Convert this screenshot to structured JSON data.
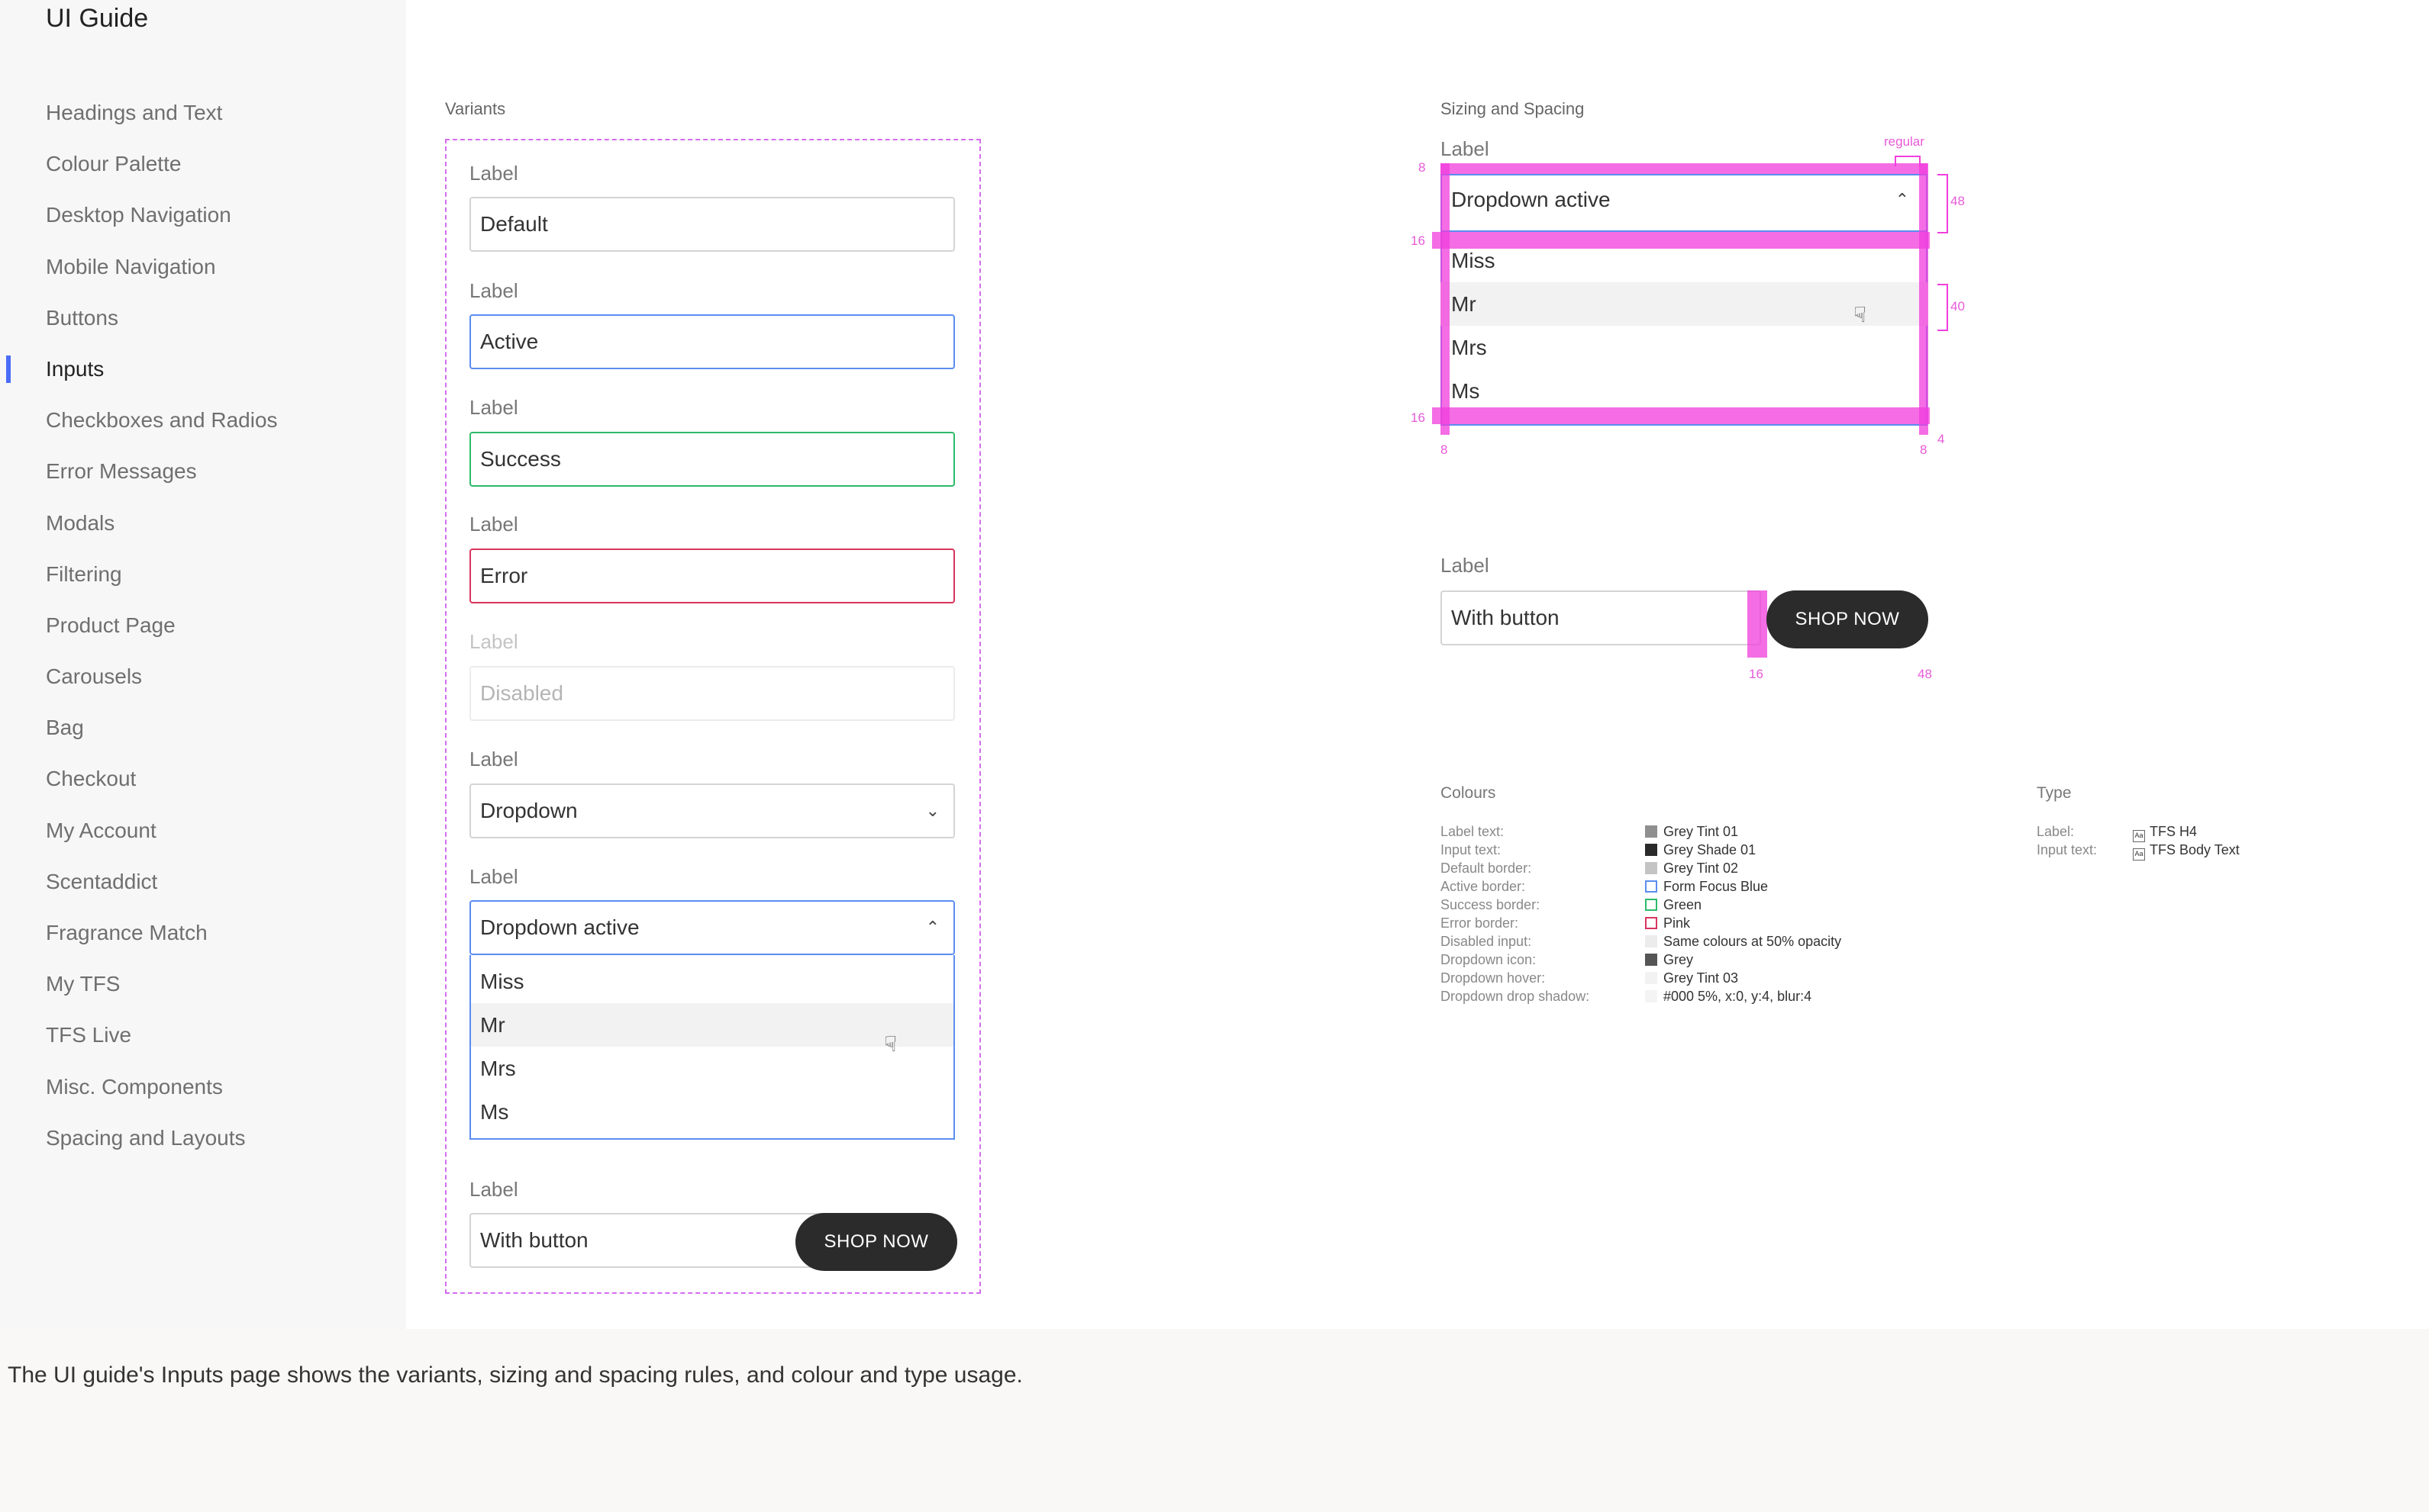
{
  "app": {
    "title": "UI Guide"
  },
  "nav": [
    "Headings and Text",
    "Colour Palette",
    "Desktop Navigation",
    "Mobile Navigation",
    "Buttons",
    "Inputs",
    "Checkboxes and Radios",
    "Error Messages",
    "Modals",
    "Filtering",
    "Product Page",
    "Carousels",
    "Bag",
    "Checkout",
    "My Account",
    "Scentaddict",
    "Fragrance Match",
    "My TFS",
    "TFS Live",
    "Misc. Components",
    "Spacing and Layouts"
  ],
  "active_nav": "Inputs",
  "variants": {
    "title": "Variants",
    "field_label": "Label",
    "default": "Default",
    "active": "Active",
    "success": "Success",
    "error": "Error",
    "disabled": "Disabled",
    "dropdown": "Dropdown",
    "dropdown_active": "Dropdown active",
    "options": [
      "Miss",
      "Mr",
      "Mrs",
      "Ms"
    ],
    "hovered_option": "Mr",
    "with_button": "With button",
    "button": "SHOP NOW"
  },
  "spacing": {
    "title": "Sizing and Spacing",
    "label": "Label",
    "dropdown_value": "Dropdown active",
    "options": [
      "Miss",
      "Mr",
      "Mrs",
      "Ms"
    ],
    "regular": "regular",
    "dims": {
      "pad_8": "8",
      "pad_16": "16",
      "height_48": "48",
      "row_40": "40",
      "radius_4": "4"
    },
    "with_button_label": "Label",
    "with_button_value": "With button",
    "button": "SHOP NOW",
    "gap_16": "16",
    "btn_48": "48"
  },
  "colours": {
    "title": "Colours",
    "rows": [
      {
        "key": "Label text:",
        "value": "Grey Tint 01",
        "swatch": "#8f8f8f",
        "style": "fill"
      },
      {
        "key": "Input text:",
        "value": "Grey Shade 01",
        "swatch": "#2a2a2a",
        "style": "fill"
      },
      {
        "key": "Default border:",
        "value": "Grey Tint 02",
        "swatch": "#c4c4c4",
        "style": "fill"
      },
      {
        "key": "Active border:",
        "value": "Form Focus Blue",
        "swatch": "#5a8df0",
        "style": "outline"
      },
      {
        "key": "Success border:",
        "value": "Green",
        "swatch": "#2dbb6a",
        "style": "outline"
      },
      {
        "key": "Error border:",
        "value": "Pink",
        "swatch": "#d8345f",
        "style": "outline"
      },
      {
        "key": "Disabled input:",
        "value": "Same colours at 50% opacity",
        "swatch": "#ececec",
        "style": "fill"
      },
      {
        "key": "Dropdown icon:",
        "value": "Grey",
        "swatch": "#555555",
        "style": "fill"
      },
      {
        "key": "Dropdown hover:",
        "value": "Grey Tint 03",
        "swatch": "#f2f2f2",
        "style": "fill"
      },
      {
        "key": "Dropdown drop shadow:",
        "value": "#000 5%, x:0, y:4, blur:4",
        "swatch": "#f4f4f4",
        "style": "fill"
      }
    ]
  },
  "type": {
    "title": "Type",
    "rows": [
      {
        "key": "Label:",
        "value": "TFS H4"
      },
      {
        "key": "Input text:",
        "value": "TFS Body Text"
      }
    ]
  },
  "caption": "The UI guide's Inputs page shows the variants, sizing and spacing rules, and colour and type usage."
}
